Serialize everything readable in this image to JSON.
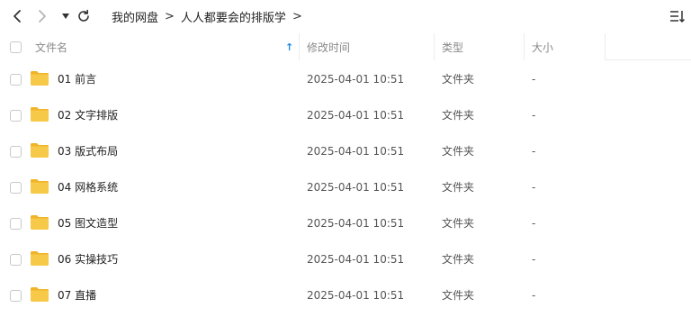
{
  "nav": {
    "back_icon": "chevron-left-icon",
    "forward_icon": "chevron-right-icon",
    "history_icon": "triangle-down-icon",
    "refresh_icon": "refresh-icon"
  },
  "breadcrumb": {
    "items": [
      "我的网盘",
      "人人都要会的排版学"
    ],
    "separator": ">"
  },
  "toolbar": {
    "sort_menu_icon": "sort-list-icon"
  },
  "columns": {
    "name": "文件名",
    "modified": "修改时间",
    "type": "类型",
    "size": "大小",
    "sort_indicator": "↑"
  },
  "colors": {
    "folder": "#f7c948",
    "folder_tab": "#f0b429",
    "accent_blue": "#1e88e5"
  },
  "files": [
    {
      "name": "01 前言",
      "modified": "2025-04-01 10:51",
      "type": "文件夹",
      "size": "-"
    },
    {
      "name": "02 文字排版",
      "modified": "2025-04-01 10:51",
      "type": "文件夹",
      "size": "-"
    },
    {
      "name": "03 版式布局",
      "modified": "2025-04-01 10:51",
      "type": "文件夹",
      "size": "-"
    },
    {
      "name": "04 网格系统",
      "modified": "2025-04-01 10:51",
      "type": "文件夹",
      "size": "-"
    },
    {
      "name": "05 图文造型",
      "modified": "2025-04-01 10:51",
      "type": "文件夹",
      "size": "-"
    },
    {
      "name": "06 实操技巧",
      "modified": "2025-04-01 10:51",
      "type": "文件夹",
      "size": "-"
    },
    {
      "name": "07 直播",
      "modified": "2025-04-01 10:51",
      "type": "文件夹",
      "size": "-"
    }
  ]
}
